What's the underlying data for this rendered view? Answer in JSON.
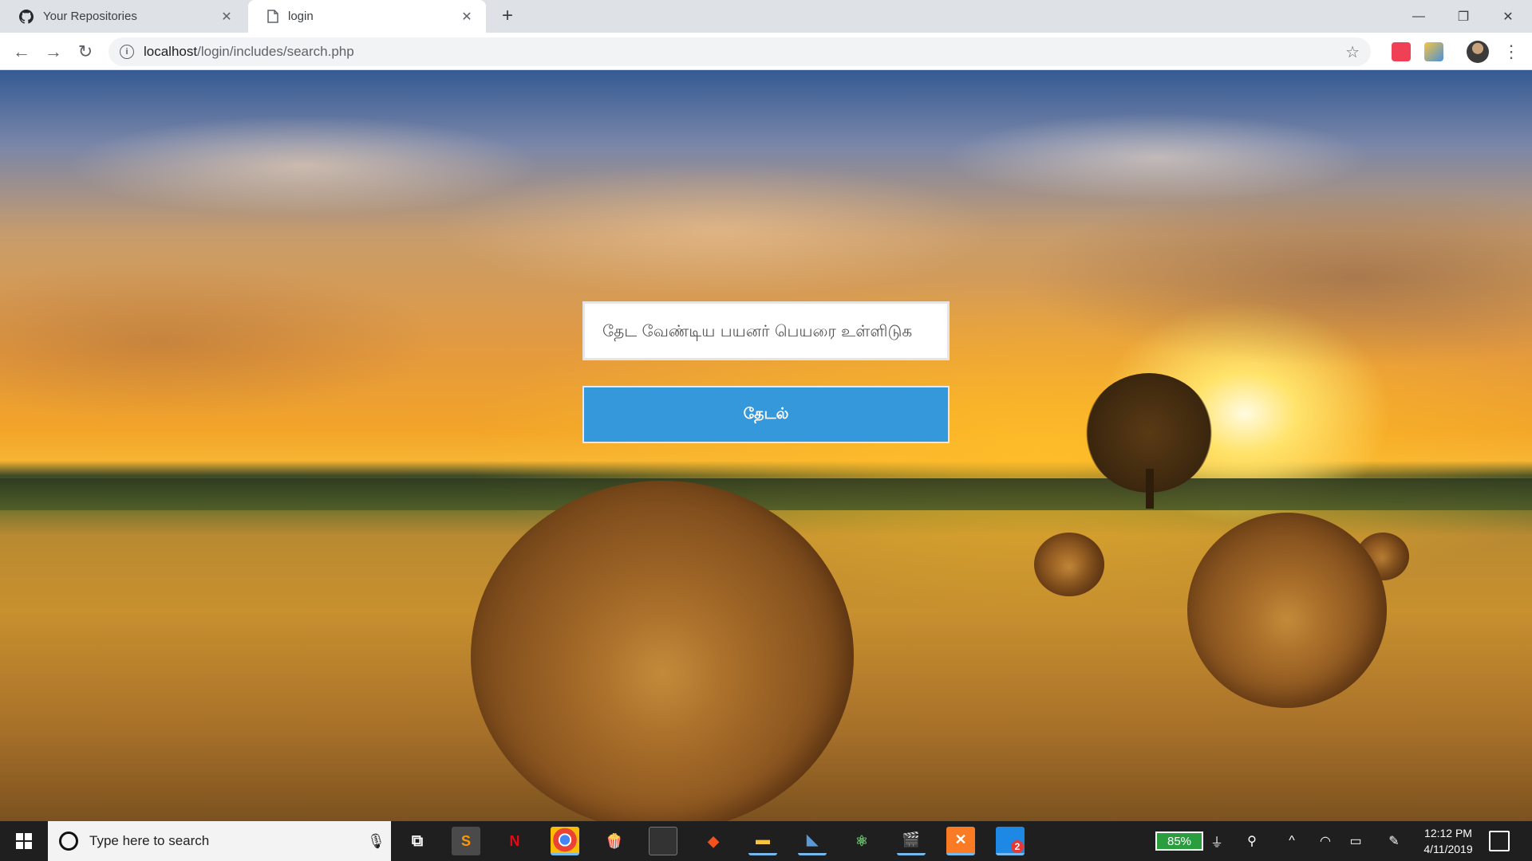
{
  "browser": {
    "tabs": [
      {
        "title": "Your Repositories",
        "icon": "github-icon"
      },
      {
        "title": "login",
        "icon": "page-icon"
      }
    ],
    "url": {
      "host": "localhost",
      "path": "/login/includes/search.php"
    }
  },
  "search": {
    "placeholder": "தேட வேண்டிய பயனர் பெயரை உள்ளிடுக",
    "button_label": "தேடல்"
  },
  "taskbar": {
    "search_placeholder": "Type here to search",
    "apps": [
      "sublime-text-icon",
      "netflix-icon",
      "chrome-icon",
      "popcorn-icon",
      "terminal-icon",
      "git-icon",
      "file-explorer-icon",
      "bird-icon",
      "atom-icon",
      "clapper-icon",
      "xampp-icon",
      "whatsapp-icon"
    ],
    "badge_count": "2",
    "battery": "85%",
    "time": "12:12 PM",
    "date": "4/11/2019"
  },
  "colors": {
    "accent_button": "#3498db",
    "taskbar": "#1f1f1f",
    "battery": "#2a9d3e"
  }
}
